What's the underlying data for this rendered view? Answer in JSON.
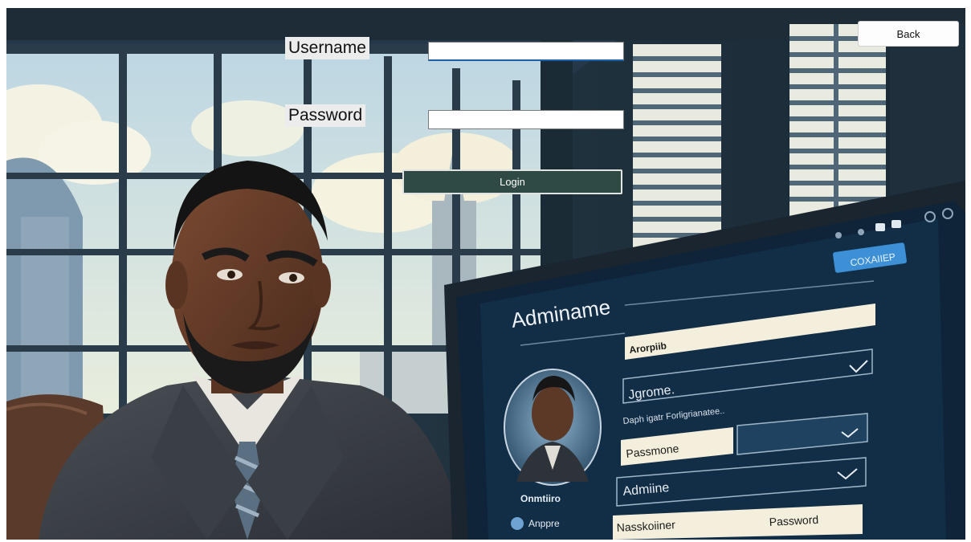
{
  "form": {
    "username_label": "Username",
    "username_value": "",
    "password_label": "Password",
    "password_value": "",
    "login_label": "Login",
    "back_label": "Back"
  },
  "background_screen": {
    "badge": "COXAIIEP",
    "title": "Adminame",
    "field1": "Arorpiib",
    "field2": "Jgrome.",
    "hint": "Daph igatr Forligrianatee..",
    "field3": "Passmone",
    "field4": "Admiine",
    "field5_left": "Nasskoiiner",
    "field5_right": "Password",
    "avatar_caption": "Onmtiiro",
    "brand": "Anppre"
  },
  "colors": {
    "login_button": "#2f4a44",
    "panel": "#0f2438",
    "accent": "#3d8fd6"
  }
}
